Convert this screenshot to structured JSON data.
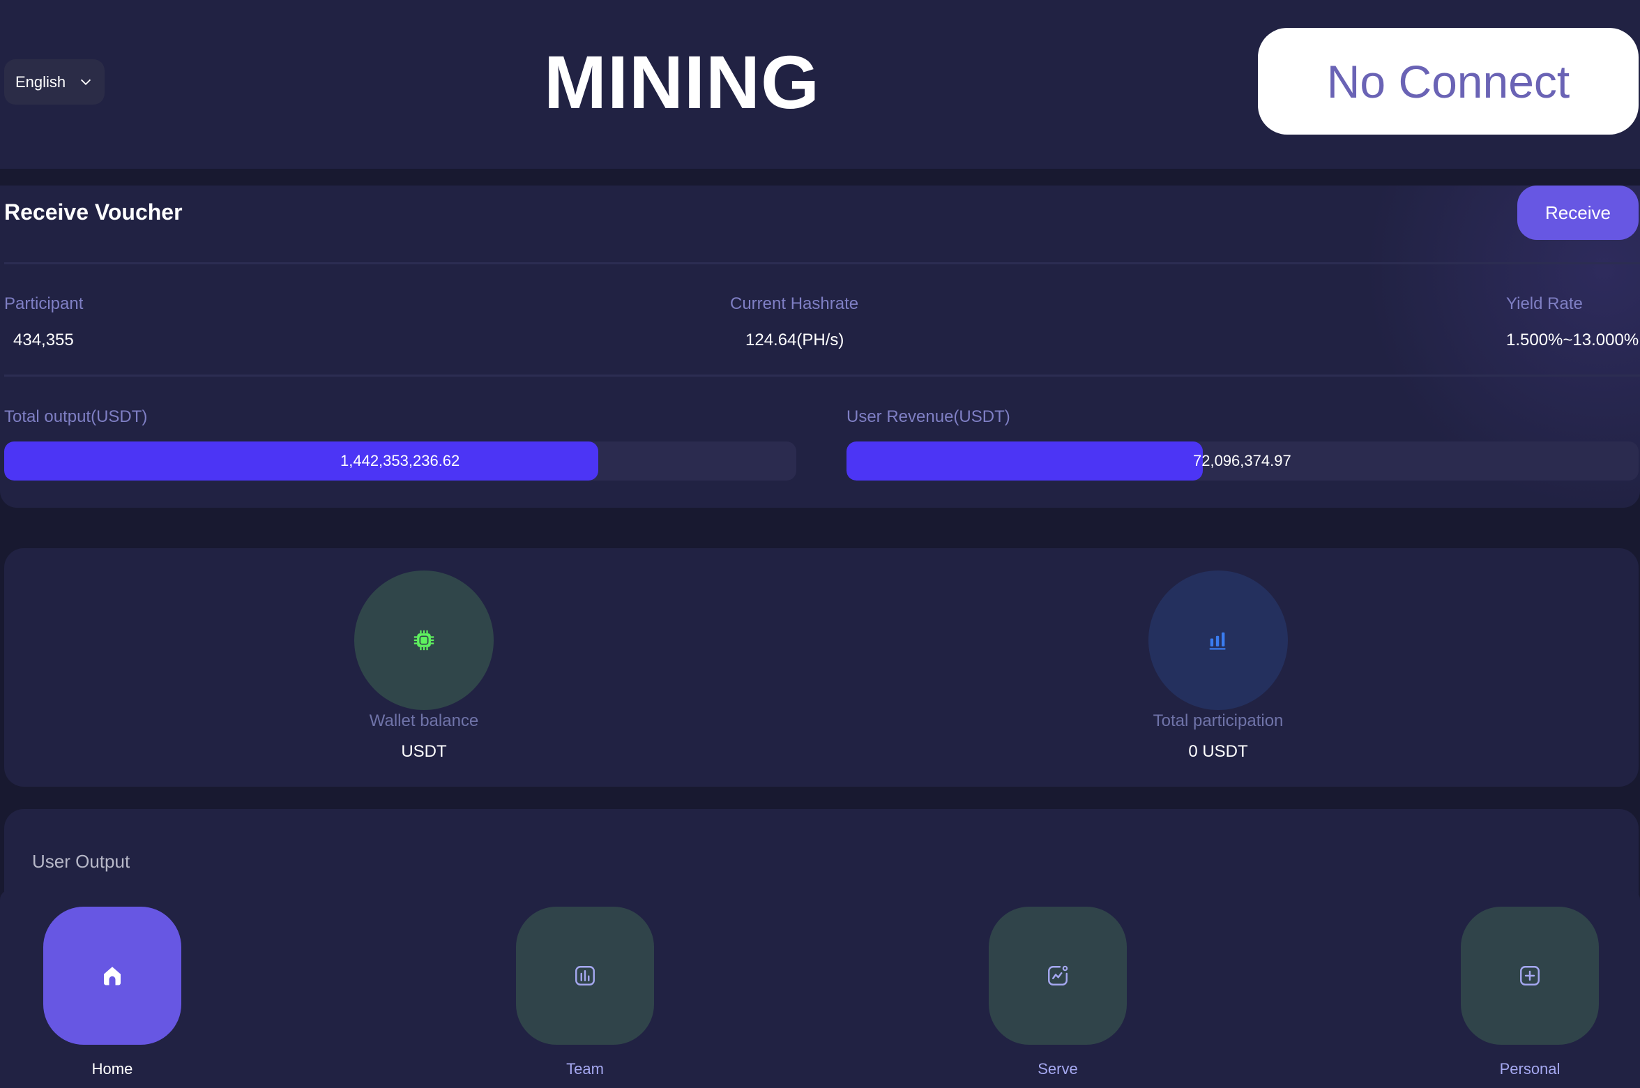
{
  "header": {
    "language": "English",
    "title": "MINING",
    "connect_label": "No Connect"
  },
  "voucher": {
    "title": "Receive Voucher",
    "receive_label": "Receive",
    "stats": [
      {
        "label": "Participant",
        "value": "434,355"
      },
      {
        "label": "Current Hashrate",
        "value": "124.64(PH/s)"
      },
      {
        "label": "Yield Rate",
        "value": "1.500%~13.000%"
      }
    ],
    "progress": [
      {
        "label": "Total output(USDT)",
        "value": "1,442,353,236.62",
        "fill_fraction": 0.75
      },
      {
        "label": "User Revenue(USDT)",
        "value": "72,096,374.97",
        "fill_fraction": 0.45
      }
    ]
  },
  "metrics": [
    {
      "icon": "chip-icon",
      "label": "Wallet balance",
      "value": "USDT",
      "circle_color": "#30464a",
      "icon_color": "#5ff25f"
    },
    {
      "icon": "bar-chart-icon",
      "label": "Total participation",
      "value": "0 USDT",
      "circle_color": "#24305e",
      "icon_color": "#3a7cf0"
    }
  ],
  "user_output": {
    "title": "User Output"
  },
  "nav": {
    "items": [
      {
        "label": "Home",
        "icon": "home-icon",
        "active": true
      },
      {
        "label": "Team",
        "icon": "chart-square-icon",
        "active": false
      },
      {
        "label": "Serve",
        "icon": "trend-square-icon",
        "active": false
      },
      {
        "label": "Personal",
        "icon": "plus-square-icon",
        "active": false
      }
    ]
  },
  "colors": {
    "background": "#181930",
    "panel": "#212243",
    "accent": "#6757e3",
    "progress_fill": "#4c35f5",
    "progress_track": "#2b2b4f",
    "muted_label": "#7f7fc4",
    "connect_text": "#6a63b5",
    "nav_tile_inactive": "#30444a",
    "nav_icon_inactive": "#a5a8f0"
  }
}
